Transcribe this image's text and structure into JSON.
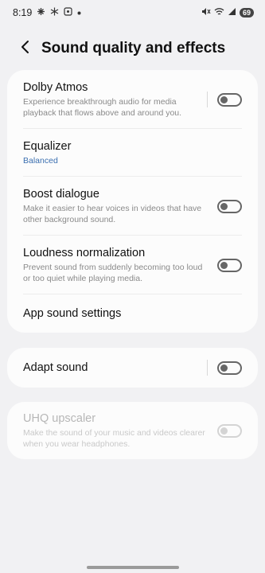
{
  "status_bar": {
    "time": "8:19",
    "battery": "69",
    "left_icons": [
      "grid-icon",
      "snowflake-icon",
      "screenshot-icon",
      "dot-icon"
    ],
    "right_icons": [
      "mute-icon",
      "wifi-icon",
      "signal-icon"
    ]
  },
  "header": {
    "title": "Sound quality and effects"
  },
  "group1": {
    "dolby": {
      "title": "Dolby Atmos",
      "subtitle": "Experience breakthrough audio for media playback that flows above and around you.",
      "enabled": false
    },
    "equalizer": {
      "title": "Equalizer",
      "value": "Balanced"
    },
    "boost": {
      "title": "Boost dialogue",
      "subtitle": "Make it easier to hear voices in videos that have other background sound.",
      "enabled": false
    },
    "loudness": {
      "title": "Loudness normalization",
      "subtitle": "Prevent sound from suddenly becoming too loud or too quiet while playing media.",
      "enabled": false
    },
    "app_sound": {
      "title": "App sound settings"
    }
  },
  "group2": {
    "adapt": {
      "title": "Adapt sound",
      "enabled": false
    }
  },
  "group3": {
    "uhq": {
      "title": "UHQ upscaler",
      "subtitle": "Make the sound of your music and videos clearer when you wear headphones.",
      "enabled": false,
      "disabled": true
    }
  },
  "colors": {
    "background": "#f1f1f3",
    "card": "#fcfcfc",
    "accent": "#3b6fb0",
    "toggle_off": "#666666",
    "disabled": "#d4d4d4"
  }
}
